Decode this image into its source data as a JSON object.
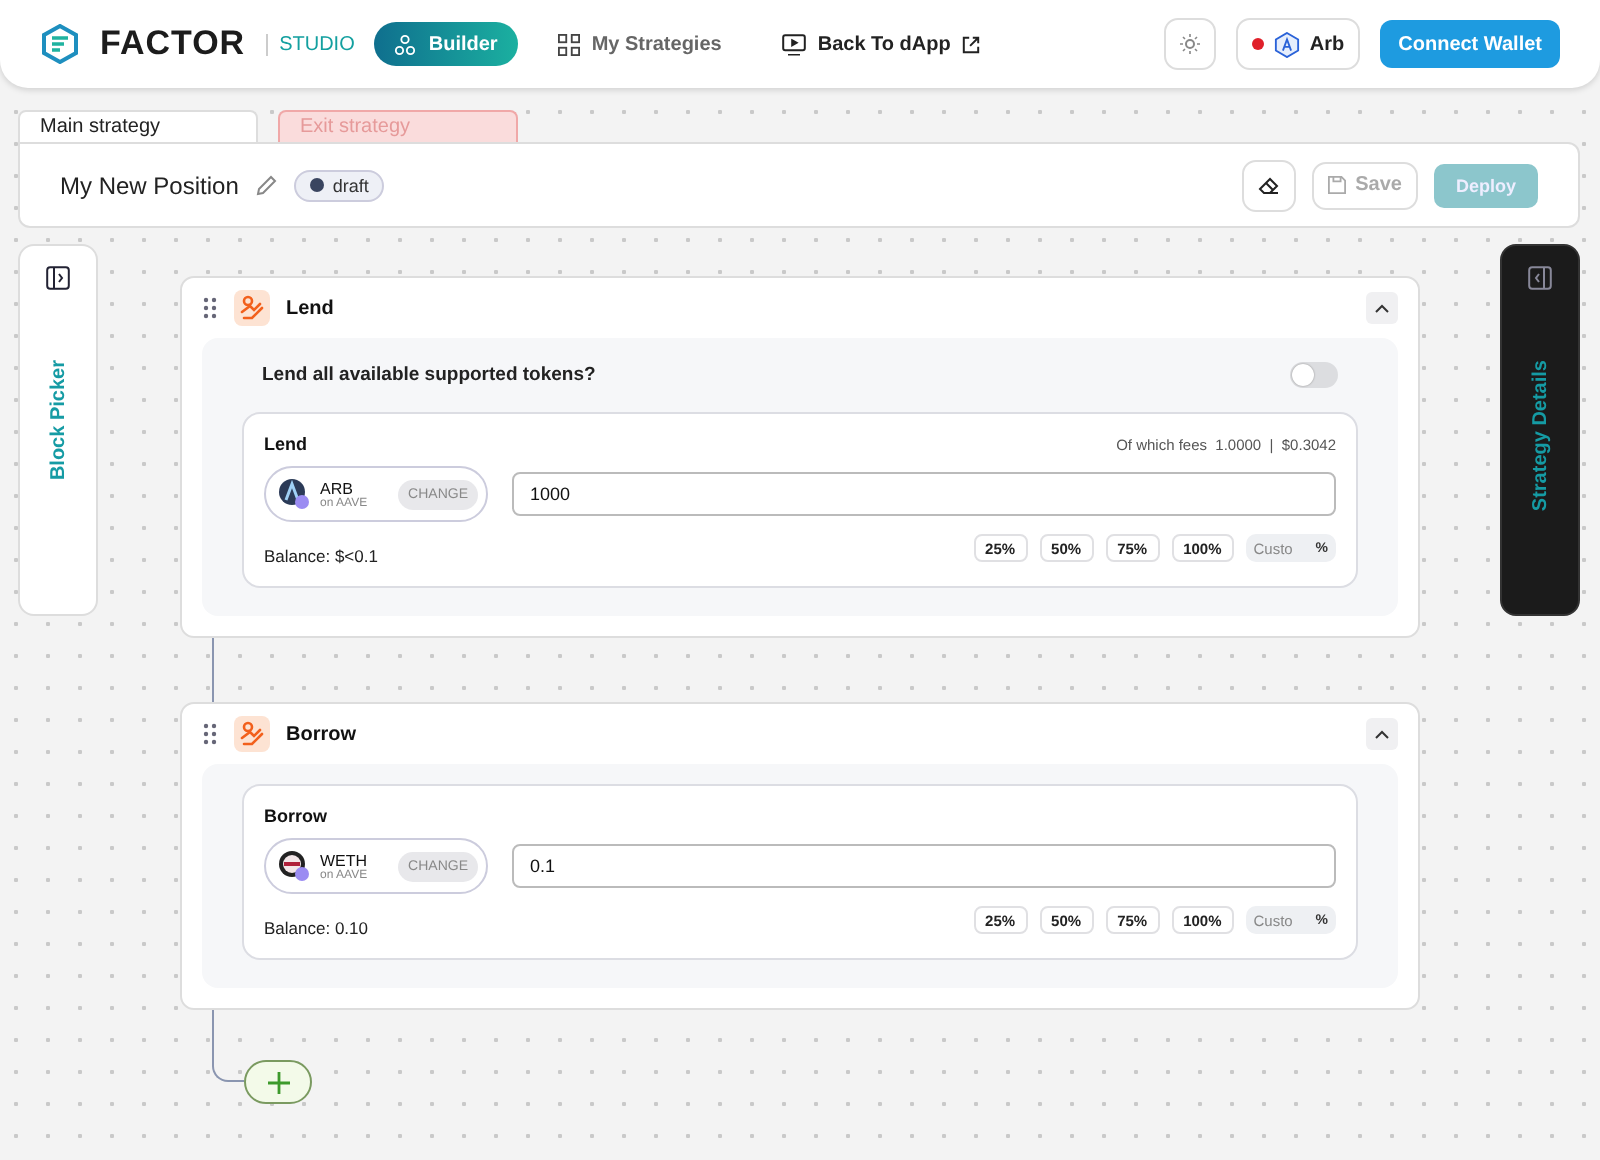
{
  "header": {
    "logo": "FACTOR",
    "logo_sub": "STUDIO",
    "nav": [
      {
        "label": "Builder",
        "kind": "builder",
        "selected": true
      },
      {
        "label": "My Strategies",
        "kind": "grid",
        "selected": false
      },
      {
        "label": "Back To dApp",
        "kind": "external",
        "selected": false
      }
    ],
    "network": "Arb",
    "connect": "Connect Wallet"
  },
  "strategy_tabs": [
    {
      "label": "Main strategy",
      "selected": true
    },
    {
      "label": "Exit strategy",
      "selected": false
    }
  ],
  "position": {
    "name": "My New Position",
    "status": "draft",
    "save": {
      "label": "Save",
      "disabled": true
    },
    "deploy": {
      "label": "Deploy",
      "disabled": true
    }
  },
  "block_picker": {
    "label": "Block Picker"
  },
  "strategy_details": {
    "label": "Strategy Details"
  },
  "blocks": [
    {
      "title": "Lend",
      "toggle": {
        "label": "Lend all available supported tokens?",
        "on": false
      },
      "field": {
        "label": "Lend",
        "fees_label": "Of which fees",
        "fees_amount": "1.0000",
        "fees_sep": "|",
        "fees_usd": "$0.3042",
        "token": "ARB",
        "kind": "arb",
        "protocol": "on AAVE",
        "change": "CHANGE",
        "value": "1000",
        "balance": "Balance: $<0.1",
        "presets": [
          "25%",
          "50%",
          "75%",
          "100%"
        ],
        "custom_placeholder": "Custo",
        "custom_suffix": "%"
      }
    },
    {
      "title": "Borrow",
      "field": {
        "label": "Borrow",
        "token": "WETH",
        "kind": "weth",
        "protocol": "on AAVE",
        "change": "CHANGE",
        "value": "0.1",
        "balance": "Balance: 0.10",
        "presets": [
          "25%",
          "50%",
          "75%",
          "100%"
        ],
        "custom_placeholder": "Custo",
        "custom_suffix": "%"
      }
    }
  ]
}
